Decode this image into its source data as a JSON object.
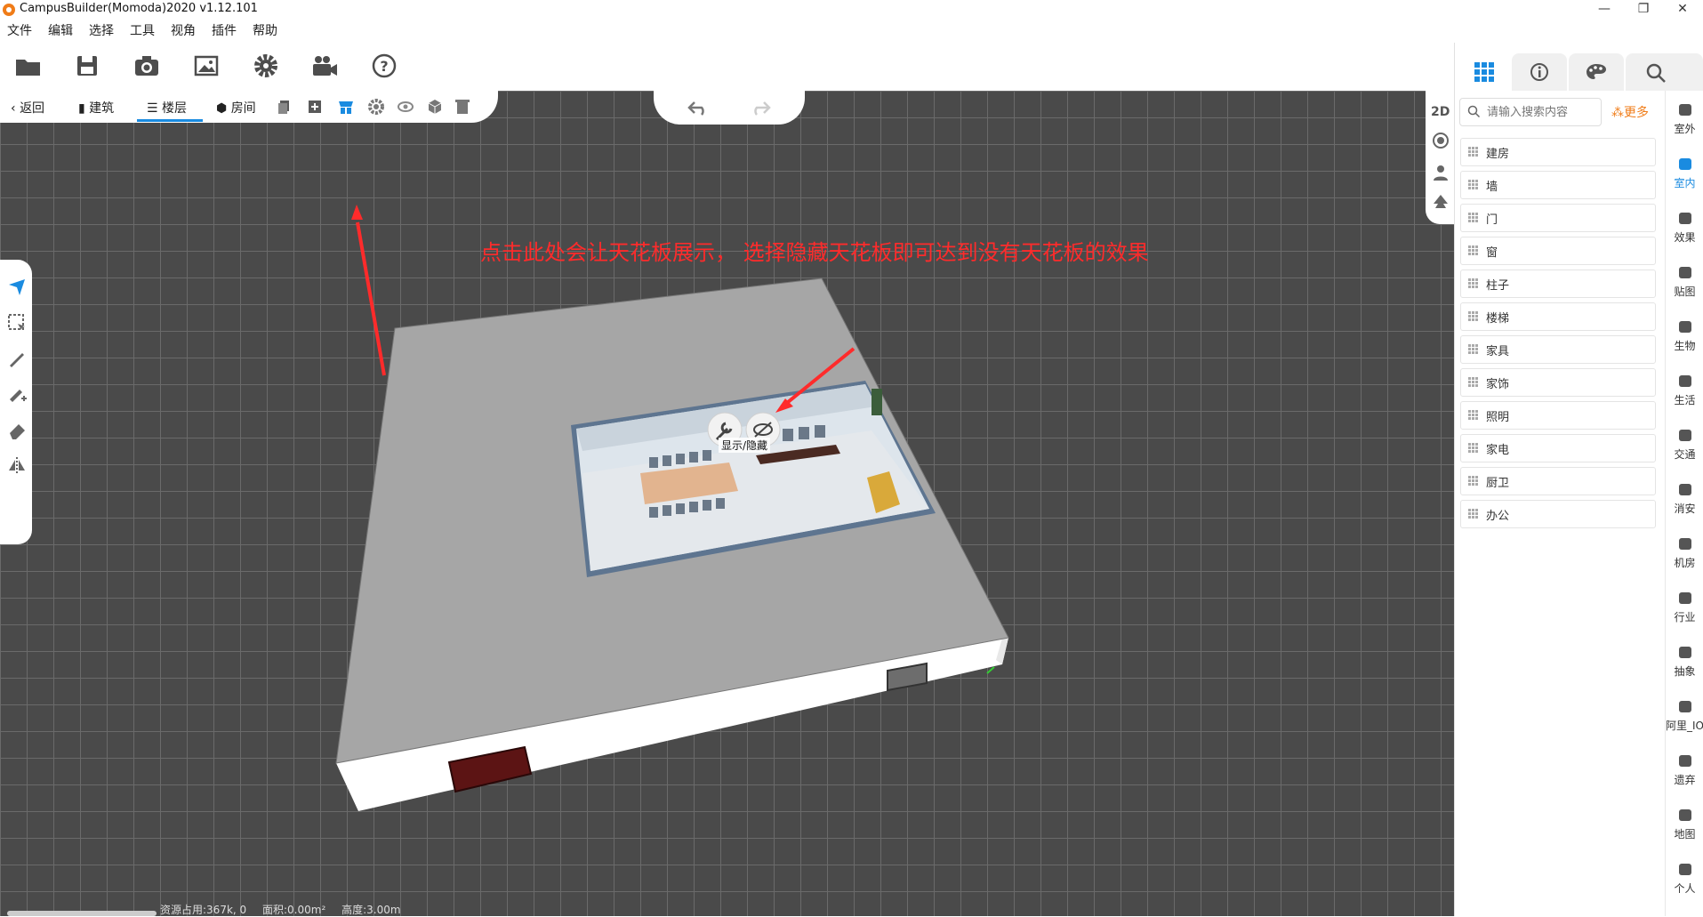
{
  "window": {
    "title": "CampusBuilder(Momoda)2020 v1.12.101",
    "controls": [
      "—",
      "❐",
      "✕"
    ]
  },
  "menu": [
    "文件",
    "编辑",
    "选择",
    "工具",
    "视角",
    "插件",
    "帮助"
  ],
  "toolbar": {
    "icons": [
      "open-folder-icon",
      "save-icon",
      "camera-icon",
      "image-icon",
      "settings-icon",
      "video-camera-icon",
      "help-icon"
    ]
  },
  "subbar": {
    "back_label": "返回",
    "building_label": "建筑",
    "floor_label": "楼层",
    "room_label": "房间",
    "active_tab": "楼层"
  },
  "view_strip": {
    "mode_label": "2D"
  },
  "annotation": {
    "text": "点击此处会让天花板展示，  选择隐藏天花板即可达到没有天花板的效果",
    "color": "#ff2b2b"
  },
  "room_popup": {
    "tooltip": "显示/隐藏"
  },
  "right_panel": {
    "search_placeholder": "请输入搜索内容",
    "more_label": "更多",
    "categories": [
      "建房",
      "墙",
      "门",
      "窗",
      "柱子",
      "楼梯",
      "家具",
      "家饰",
      "照明",
      "家电",
      "厨卫",
      "办公"
    ]
  },
  "side_categories": [
    "室外",
    "室内",
    "效果",
    "贴图",
    "生物",
    "生活",
    "交通",
    "消安",
    "机房",
    "行业",
    "抽象",
    "阿里_IO",
    "遗弃",
    "地图",
    "个人"
  ],
  "side_active": "室内",
  "status": {
    "resource": "资源占用:367k, 0",
    "area": "面积:0.00m²",
    "height": "高度:3.00m"
  },
  "colors": {
    "accent": "#1a8be0",
    "more": "#f07c18",
    "grid_bg": "#4a4a4a"
  }
}
